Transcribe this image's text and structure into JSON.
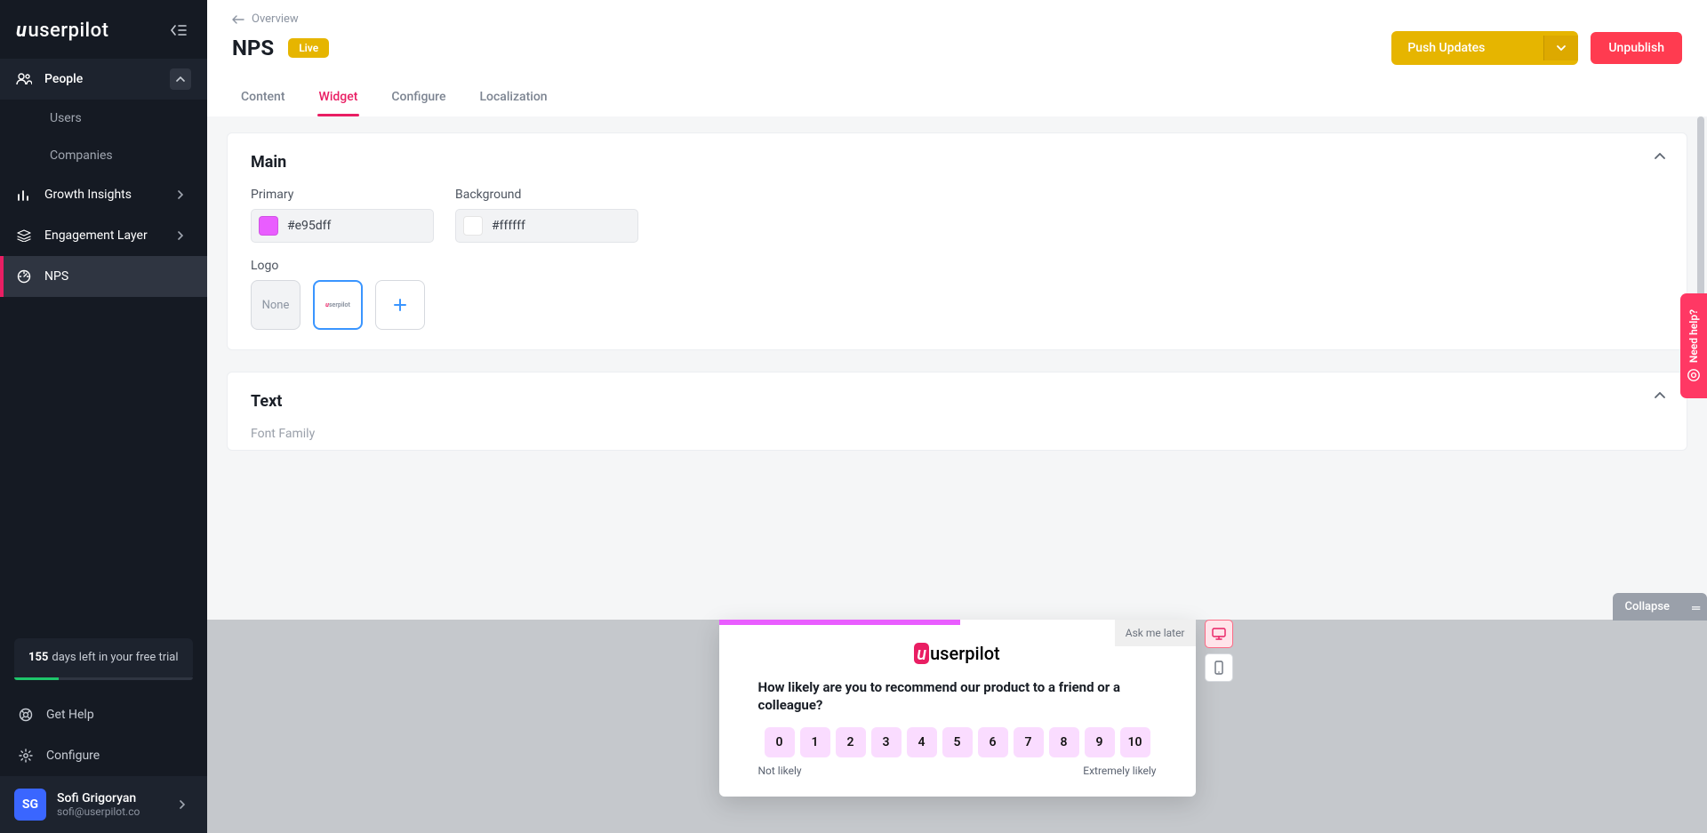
{
  "brand": "userpilot",
  "sidebar": {
    "sections": [
      {
        "key": "people",
        "label": "People",
        "expanded": true,
        "subs": [
          {
            "label": "Users"
          },
          {
            "label": "Companies"
          }
        ]
      },
      {
        "key": "growth",
        "label": "Growth Insights",
        "expanded": false
      },
      {
        "key": "engagement",
        "label": "Engagement Layer",
        "expanded": false
      },
      {
        "key": "nps",
        "label": "NPS",
        "active": true
      }
    ],
    "trial": {
      "days": "155",
      "text": "days left in your free trial"
    },
    "help_label": "Get Help",
    "configure_label": "Configure",
    "user": {
      "initials": "SG",
      "name": "Sofi Grigoryan",
      "email": "sofi@userpilot.co"
    }
  },
  "header": {
    "back_label": "Overview",
    "title": "NPS",
    "badge": "Live",
    "push_label": "Push Updates",
    "unpublish_label": "Unpublish",
    "tabs": [
      {
        "label": "Content"
      },
      {
        "label": "Widget",
        "active": true
      },
      {
        "label": "Configure"
      },
      {
        "label": "Localization"
      }
    ]
  },
  "widget": {
    "main": {
      "title": "Main",
      "primary_label": "Primary",
      "primary_value": "#e95dff",
      "background_label": "Background",
      "background_value": "#ffffff",
      "logo_label": "Logo",
      "logo_none": "None"
    },
    "text": {
      "title": "Text",
      "font_family_label": "Font Family"
    }
  },
  "preview": {
    "ask_later": "Ask me later",
    "brand": "userpilot",
    "question": "How likely are you to recommend our product to a friend or a colleague?",
    "scores": [
      "0",
      "1",
      "2",
      "3",
      "4",
      "5",
      "6",
      "7",
      "8",
      "9",
      "10"
    ],
    "low_label": "Not likely",
    "high_label": "Extremely likely",
    "collapse_label": "Collapse"
  },
  "help_tab": "Need help?"
}
